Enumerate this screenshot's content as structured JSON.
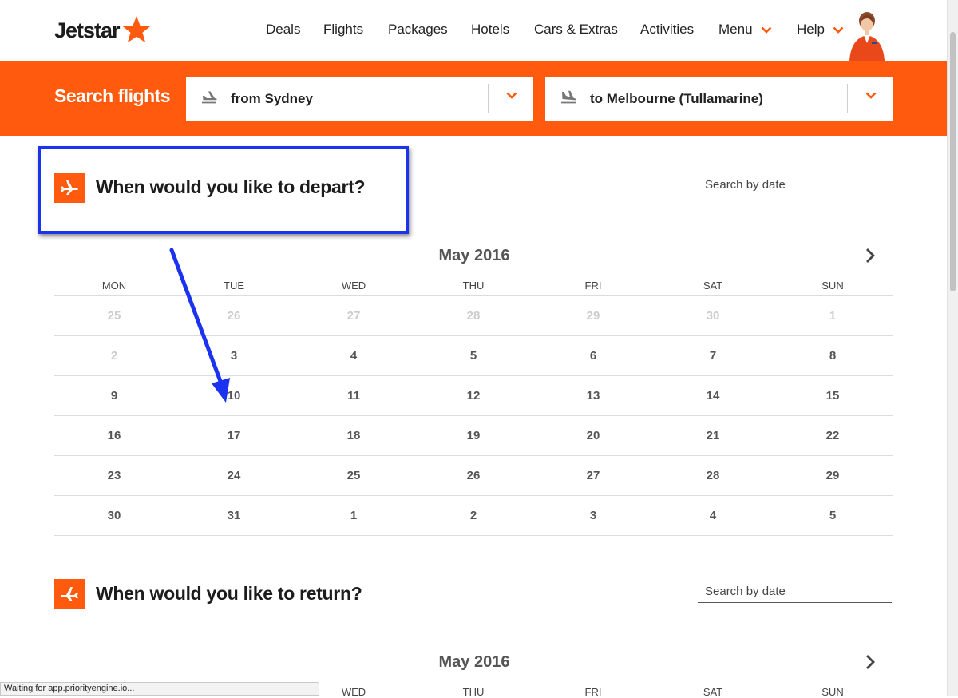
{
  "brand": {
    "name": "Jetstar",
    "accent": "#ff5a0e"
  },
  "nav": {
    "items": [
      {
        "label": "Deals"
      },
      {
        "label": "Flights"
      },
      {
        "label": "Packages"
      },
      {
        "label": "Hotels"
      },
      {
        "label": "Cars & Extras"
      },
      {
        "label": "Activities"
      },
      {
        "label": "Menu"
      },
      {
        "label": "Help"
      }
    ]
  },
  "search": {
    "title": "Search flights",
    "from": "from Sydney",
    "to": "to Melbourne (Tullamarine)"
  },
  "depart": {
    "title": "When would you like to depart?",
    "date_search_placeholder": "Search by date",
    "month": "May 2016",
    "weekdays": [
      "MON",
      "TUE",
      "WED",
      "THU",
      "FRI",
      "SAT",
      "SUN"
    ],
    "weeks": [
      [
        {
          "d": "25",
          "muted": true
        },
        {
          "d": "26",
          "muted": true
        },
        {
          "d": "27",
          "muted": true
        },
        {
          "d": "28",
          "muted": true
        },
        {
          "d": "29",
          "muted": true
        },
        {
          "d": "30",
          "muted": true
        },
        {
          "d": "1",
          "muted": true
        }
      ],
      [
        {
          "d": "2",
          "muted": true
        },
        {
          "d": "3",
          "muted": false
        },
        {
          "d": "4",
          "muted": false
        },
        {
          "d": "5",
          "muted": false
        },
        {
          "d": "6",
          "muted": false
        },
        {
          "d": "7",
          "muted": false
        },
        {
          "d": "8",
          "muted": false
        }
      ],
      [
        {
          "d": "9",
          "muted": false
        },
        {
          "d": "10",
          "muted": false
        },
        {
          "d": "11",
          "muted": false
        },
        {
          "d": "12",
          "muted": false
        },
        {
          "d": "13",
          "muted": false
        },
        {
          "d": "14",
          "muted": false
        },
        {
          "d": "15",
          "muted": false
        }
      ],
      [
        {
          "d": "16",
          "muted": false
        },
        {
          "d": "17",
          "muted": false
        },
        {
          "d": "18",
          "muted": false
        },
        {
          "d": "19",
          "muted": false
        },
        {
          "d": "20",
          "muted": false
        },
        {
          "d": "21",
          "muted": false
        },
        {
          "d": "22",
          "muted": false
        }
      ],
      [
        {
          "d": "23",
          "muted": false
        },
        {
          "d": "24",
          "muted": false
        },
        {
          "d": "25",
          "muted": false
        },
        {
          "d": "26",
          "muted": false
        },
        {
          "d": "27",
          "muted": false
        },
        {
          "d": "28",
          "muted": false
        },
        {
          "d": "29",
          "muted": false
        }
      ],
      [
        {
          "d": "30",
          "muted": false
        },
        {
          "d": "31",
          "muted": false
        },
        {
          "d": "1",
          "muted": false
        },
        {
          "d": "2",
          "muted": false
        },
        {
          "d": "3",
          "muted": false
        },
        {
          "d": "4",
          "muted": false
        },
        {
          "d": "5",
          "muted": false
        }
      ]
    ]
  },
  "return": {
    "title": "When would you like to return?",
    "date_search_placeholder": "Search by date",
    "month": "May 2016",
    "weekdays": [
      "WED",
      "THU",
      "FRI",
      "SAT",
      "SUN"
    ]
  },
  "status_text": "Waiting for app.priorityengine.io...",
  "annotation": {
    "color": "#1b32f1"
  }
}
